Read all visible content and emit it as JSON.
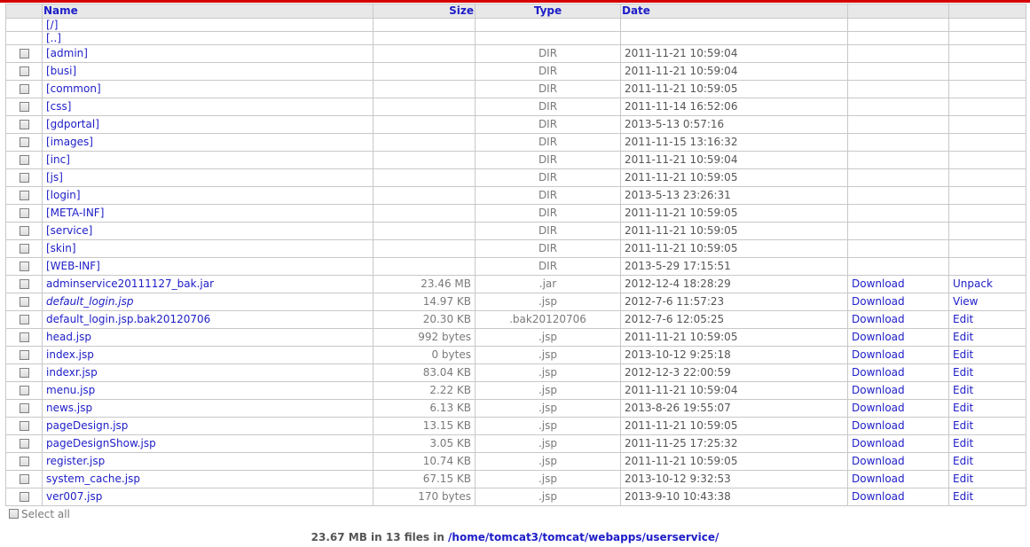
{
  "header": {
    "name": "Name",
    "size": "Size",
    "type": "Type",
    "date": "Date"
  },
  "nav": [
    "[/]",
    "[..]"
  ],
  "actions": {
    "download": "Download"
  },
  "rows": [
    {
      "name": "[admin]",
      "size": "",
      "type": "DIR",
      "date": "2011-11-21 10:59:04",
      "dl": "",
      "act": ""
    },
    {
      "name": "[busi]",
      "size": "",
      "type": "DIR",
      "date": "2011-11-21 10:59:04",
      "dl": "",
      "act": ""
    },
    {
      "name": "[common]",
      "size": "",
      "type": "DIR",
      "date": "2011-11-21 10:59:05",
      "dl": "",
      "act": ""
    },
    {
      "name": "[css]",
      "size": "",
      "type": "DIR",
      "date": "2011-11-14 16:52:06",
      "dl": "",
      "act": ""
    },
    {
      "name": "[gdportal]",
      "size": "",
      "type": "DIR",
      "date": "2013-5-13 0:57:16",
      "dl": "",
      "act": ""
    },
    {
      "name": "[images]",
      "size": "",
      "type": "DIR",
      "date": "2011-11-15 13:16:32",
      "dl": "",
      "act": ""
    },
    {
      "name": "[inc]",
      "size": "",
      "type": "DIR",
      "date": "2011-11-21 10:59:04",
      "dl": "",
      "act": ""
    },
    {
      "name": "[js]",
      "size": "",
      "type": "DIR",
      "date": "2011-11-21 10:59:05",
      "dl": "",
      "act": ""
    },
    {
      "name": "[login]",
      "size": "",
      "type": "DIR",
      "date": "2013-5-13 23:26:31",
      "dl": "",
      "act": ""
    },
    {
      "name": "[META-INF]",
      "size": "",
      "type": "DIR",
      "date": "2011-11-21 10:59:05",
      "dl": "",
      "act": ""
    },
    {
      "name": "[service]",
      "size": "",
      "type": "DIR",
      "date": "2011-11-21 10:59:05",
      "dl": "",
      "act": ""
    },
    {
      "name": "[skin]",
      "size": "",
      "type": "DIR",
      "date": "2011-11-21 10:59:05",
      "dl": "",
      "act": ""
    },
    {
      "name": "[WEB-INF]",
      "size": "",
      "type": "DIR",
      "date": "2013-5-29 17:15:51",
      "dl": "",
      "act": ""
    },
    {
      "name": "adminservice20111127_bak.jar",
      "size": "23.46 MB",
      "type": ".jar",
      "date": "2012-12-4 18:28:29",
      "dl": "Download",
      "act": "Unpack"
    },
    {
      "name": "default_login.jsp",
      "size": "14.97 KB",
      "type": ".jsp",
      "date": "2012-7-6 11:57:23",
      "dl": "Download",
      "act": "View",
      "italic": true
    },
    {
      "name": "default_login.jsp.bak20120706",
      "size": "20.30 KB",
      "type": ".bak20120706",
      "date": "2012-7-6 12:05:25",
      "dl": "Download",
      "act": "Edit"
    },
    {
      "name": "head.jsp",
      "size": "992 bytes",
      "type": ".jsp",
      "date": "2011-11-21 10:59:05",
      "dl": "Download",
      "act": "Edit"
    },
    {
      "name": "index.jsp",
      "size": "0 bytes",
      "type": ".jsp",
      "date": "2013-10-12 9:25:18",
      "dl": "Download",
      "act": "Edit"
    },
    {
      "name": "indexr.jsp",
      "size": "83.04 KB",
      "type": ".jsp",
      "date": "2012-12-3 22:00:59",
      "dl": "Download",
      "act": "Edit"
    },
    {
      "name": "menu.jsp",
      "size": "2.22 KB",
      "type": ".jsp",
      "date": "2011-11-21 10:59:04",
      "dl": "Download",
      "act": "Edit"
    },
    {
      "name": "news.jsp",
      "size": "6.13 KB",
      "type": ".jsp",
      "date": "2013-8-26 19:55:07",
      "dl": "Download",
      "act": "Edit"
    },
    {
      "name": "pageDesign.jsp",
      "size": "13.15 KB",
      "type": ".jsp",
      "date": "2011-11-21 10:59:05",
      "dl": "Download",
      "act": "Edit"
    },
    {
      "name": "pageDesignShow.jsp",
      "size": "3.05 KB",
      "type": ".jsp",
      "date": "2011-11-25 17:25:32",
      "dl": "Download",
      "act": "Edit"
    },
    {
      "name": "register.jsp",
      "size": "10.74 KB",
      "type": ".jsp",
      "date": "2011-11-21 10:59:05",
      "dl": "Download",
      "act": "Edit"
    },
    {
      "name": "system_cache.jsp",
      "size": "67.15 KB",
      "type": ".jsp",
      "date": "2013-10-12 9:32:53",
      "dl": "Download",
      "act": "Edit"
    },
    {
      "name": "ver007.jsp",
      "size": "170 bytes",
      "type": ".jsp",
      "date": "2013-9-10 10:43:38",
      "dl": "Download",
      "act": "Edit"
    }
  ],
  "select_all": "Select all",
  "footer": {
    "summary": "23.67 MB in 13 files in ",
    "path": "/home/tomcat3/tomcat/webapps/userservice/"
  },
  "colors": {
    "accent_bar": "#d40000",
    "link": "#1d1dc8"
  }
}
